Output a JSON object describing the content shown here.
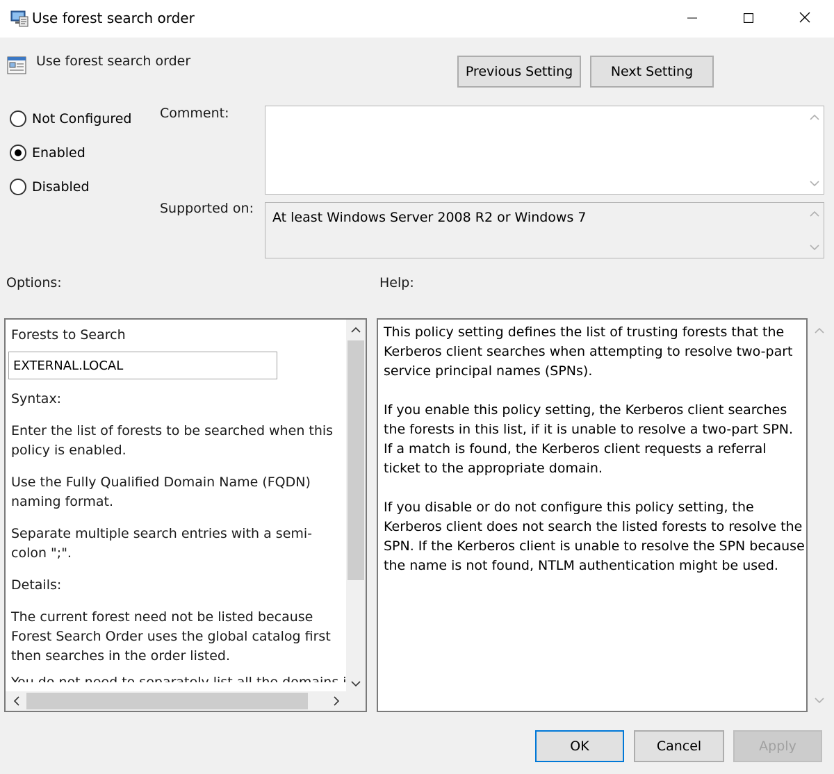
{
  "window": {
    "title": "Use forest search order",
    "minimize_icon": "minimize-icon",
    "maximize_icon": "maximize-icon",
    "close_icon": "close-icon"
  },
  "header": {
    "setting_title": "Use forest search order",
    "previous_label": "Previous Setting",
    "next_label": "Next Setting"
  },
  "state": {
    "options": [
      {
        "label": "Not Configured",
        "checked": false
      },
      {
        "label": "Enabled",
        "checked": true
      },
      {
        "label": "Disabled",
        "checked": false
      }
    ]
  },
  "comment": {
    "label": "Comment:",
    "value": ""
  },
  "supported": {
    "label": "Supported on:",
    "value": "At least Windows Server 2008 R2 or Windows 7"
  },
  "options_panel": {
    "label": "Options:",
    "forests_label": "Forests to Search",
    "forests_value": "EXTERNAL.LOCAL",
    "syntax_label": "Syntax:",
    "syntax_p1": "Enter the list of forests to be searched when this policy is enabled.",
    "syntax_p2": "Use the Fully Qualified Domain Name (FQDN) naming format.",
    "syntax_p3": "Separate multiple search entries with a semi-colon \";\".",
    "details_label": "Details:",
    "details_p1": "The current forest need not be listed because Forest Search Order uses the global catalog first then searches in the order listed.",
    "details_p2_clipped": "You do not need to separately list all the domains in"
  },
  "help_panel": {
    "label": "Help:",
    "p1": "This policy setting defines the list of trusting forests that the Kerberos client searches when attempting to resolve two-part service principal names (SPNs).",
    "p2": "If you enable this policy setting, the Kerberos client searches the forests in this list, if it is unable to resolve a two-part SPN. If a match is found, the Kerberos client requests a referral ticket to the appropriate domain.",
    "p3": "If you disable or do not configure this policy setting, the Kerberos client does not search the listed forests to resolve the SPN. If the Kerberos client is unable to resolve the SPN because the name is not found, NTLM authentication might be used."
  },
  "footer": {
    "ok_label": "OK",
    "cancel_label": "Cancel",
    "apply_label": "Apply"
  },
  "colors": {
    "ok_border": "#0078d7",
    "window_bg": "#f0f0f0"
  }
}
